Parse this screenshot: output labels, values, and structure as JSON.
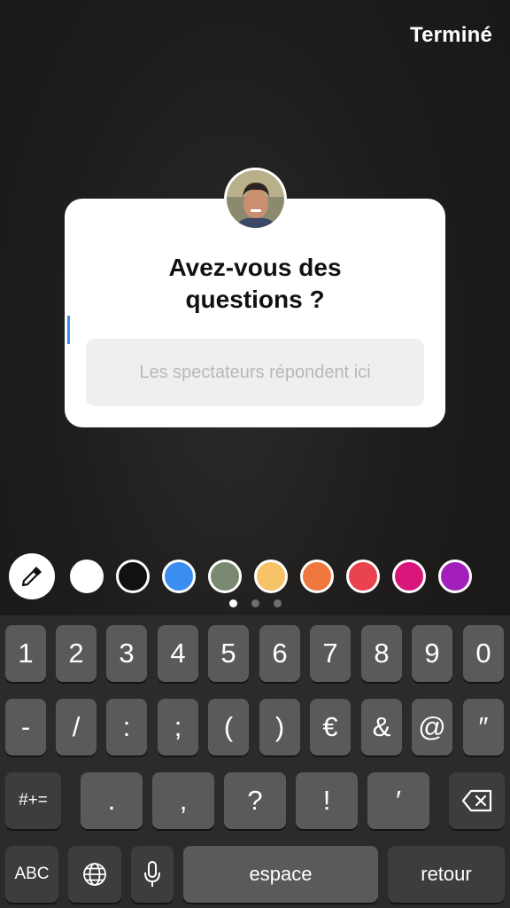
{
  "header": {
    "done_label": "Terminé"
  },
  "sticker": {
    "question_line1": "Avez-vous des",
    "question_line2": "questions ?",
    "answer_placeholder": "Les spectateurs répondent ici"
  },
  "colors": [
    "#ffffff",
    "#111111",
    "#3b8ef0",
    "#7a8a70",
    "#f6c366",
    "#f0773e",
    "#e8434f",
    "#d8157a",
    "#a21fbc"
  ],
  "keyboard": {
    "row1": [
      "1",
      "2",
      "3",
      "4",
      "5",
      "6",
      "7",
      "8",
      "9",
      "0"
    ],
    "row2": [
      "-",
      "/",
      ":",
      ";",
      "(",
      ")",
      "€",
      "&",
      "@",
      "″"
    ],
    "row3": [
      ".",
      ",",
      "?",
      "!",
      "′"
    ],
    "symbols_label": "#+=",
    "abc_label": "ABC",
    "space_label": "espace",
    "return_label": "retour"
  }
}
